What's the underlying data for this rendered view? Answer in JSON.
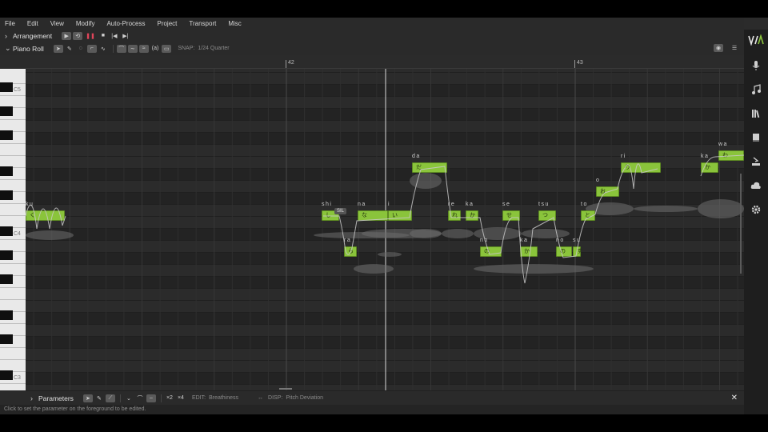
{
  "menu": [
    "File",
    "Edit",
    "View",
    "Modify",
    "Auto-Process",
    "Project",
    "Transport",
    "Misc"
  ],
  "arrangement": {
    "label": "Arrangement"
  },
  "piano_roll": {
    "label": "Piano Roll",
    "snap_label": "SNAP:",
    "snap_value": "1/24 Quarter"
  },
  "ruler": {
    "bars": [
      "42",
      "43"
    ]
  },
  "piano": {
    "labels": [
      "C5",
      "C4",
      "C3"
    ]
  },
  "notes": [
    {
      "lyric": "ku",
      "glyph": "く"
    },
    {
      "lyric": "shi",
      "glyph": "し"
    },
    {
      "lyric": "ra",
      "glyph": "ら"
    },
    {
      "lyric": "na",
      "glyph": "な"
    },
    {
      "lyric": "i",
      "glyph": "い"
    },
    {
      "lyric": "da",
      "glyph": "だ"
    },
    {
      "lyric": "re",
      "glyph": "れ"
    },
    {
      "lyric": "ka",
      "glyph": "か"
    },
    {
      "lyric": "no",
      "glyph": "の"
    },
    {
      "lyric": "se",
      "glyph": "せ"
    },
    {
      "lyric": "ka",
      "glyph": "か"
    },
    {
      "lyric": "tsu",
      "glyph": "つ"
    },
    {
      "lyric": "no",
      "glyph": "の"
    },
    {
      "lyric": "su",
      "glyph": "す"
    },
    {
      "lyric": "to",
      "glyph": "と"
    },
    {
      "lyric": "o",
      "glyph": "お"
    },
    {
      "lyric": "ri",
      "glyph": "り"
    },
    {
      "lyric": "ka",
      "glyph": "か"
    },
    {
      "lyric": "wa",
      "glyph": "わ"
    }
  ],
  "sil_tag": "SIL",
  "parameters": {
    "label": "Parameters",
    "buttons": [
      "×2",
      "×4"
    ],
    "edit_label": "EDIT:",
    "edit_value": "Breathiness",
    "disp_label": "DISP:",
    "disp_value": "Pitch Deviation"
  },
  "status_text": "Click to set the parameter on the foreground to be edited.",
  "colors": {
    "note_fill": "#8ac43b",
    "accent_red": "#e0455a",
    "background": "#2b2b2b"
  },
  "sidebar_icons": [
    "logo-icon",
    "microphone-icon",
    "music-note-icon",
    "library-icon",
    "book-icon",
    "import-icon",
    "cloud-icon",
    "gear-icon"
  ]
}
